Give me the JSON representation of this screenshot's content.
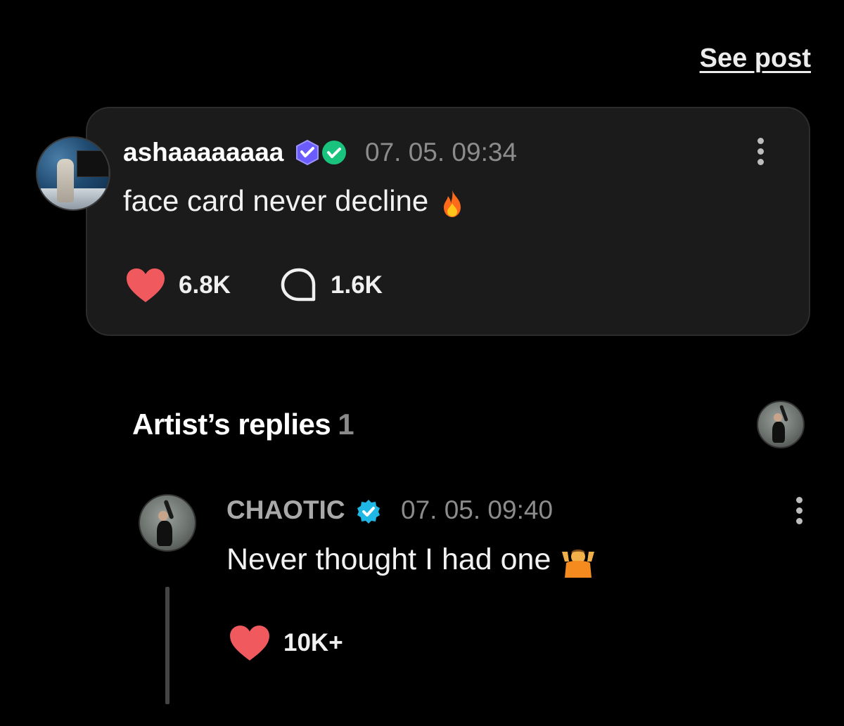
{
  "header": {
    "see_post_label": "See post"
  },
  "post": {
    "username": "ashaaaaaaaa",
    "timestamp": "07. 05. 09:34",
    "text": "face card never decline",
    "emoji": "fire",
    "likes": "6.8K",
    "comments": "1.6K",
    "avatar_icon": "user-photo"
  },
  "replies_section": {
    "title": "Artist’s replies",
    "count": "1"
  },
  "reply": {
    "name": "CHAOTIC",
    "timestamp": "07. 05. 09:40",
    "text": "Never thought I had one",
    "emoji": "person-shrugging",
    "likes": "10K+"
  },
  "colors": {
    "background": "#000000",
    "card": "#1b1b1b",
    "heart": "#f05a5f",
    "verified": "#1fb8e6",
    "badge_purple": "#6a5cff",
    "badge_green": "#19c37d",
    "muted_text": "#8c8c8c"
  }
}
